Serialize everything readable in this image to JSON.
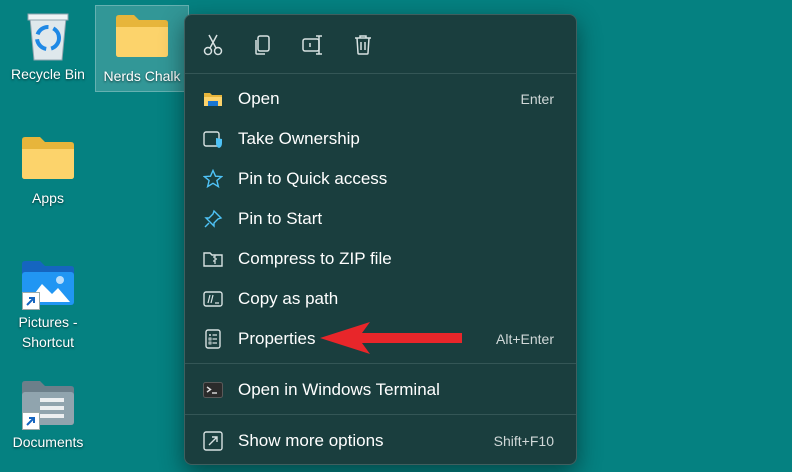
{
  "desktop": {
    "icons": [
      {
        "label": "Recycle Bin"
      },
      {
        "label": "Nerds Chalk"
      },
      {
        "label": "Apps"
      },
      {
        "label": "Pictures - Shortcut"
      },
      {
        "label": "Documents"
      }
    ]
  },
  "context_menu": {
    "toolbar": [
      {
        "icon": "cut-icon"
      },
      {
        "icon": "copy-icon"
      },
      {
        "icon": "rename-icon"
      },
      {
        "icon": "delete-icon"
      }
    ],
    "items": [
      {
        "label": "Open",
        "shortcut": "Enter",
        "icon": "folder-icon"
      },
      {
        "label": "Take Ownership",
        "shortcut": "",
        "icon": "shield-icon"
      },
      {
        "label": "Pin to Quick access",
        "shortcut": "",
        "icon": "star-icon"
      },
      {
        "label": "Pin to Start",
        "shortcut": "",
        "icon": "pin-icon"
      },
      {
        "label": "Compress to ZIP file",
        "shortcut": "",
        "icon": "zip-icon"
      },
      {
        "label": "Copy as path",
        "shortcut": "",
        "icon": "path-icon"
      },
      {
        "label": "Properties",
        "shortcut": "Alt+Enter",
        "icon": "properties-icon"
      },
      {
        "label": "Open in Windows Terminal",
        "shortcut": "",
        "icon": "terminal-icon"
      },
      {
        "label": "Show more options",
        "shortcut": "Shift+F10",
        "icon": "more-options-icon"
      }
    ]
  },
  "colors": {
    "desktop_bg": "#058181",
    "menu_bg": "#1a3e3e",
    "accent": "#4fc3f7",
    "annotation_arrow": "#e8262a"
  }
}
